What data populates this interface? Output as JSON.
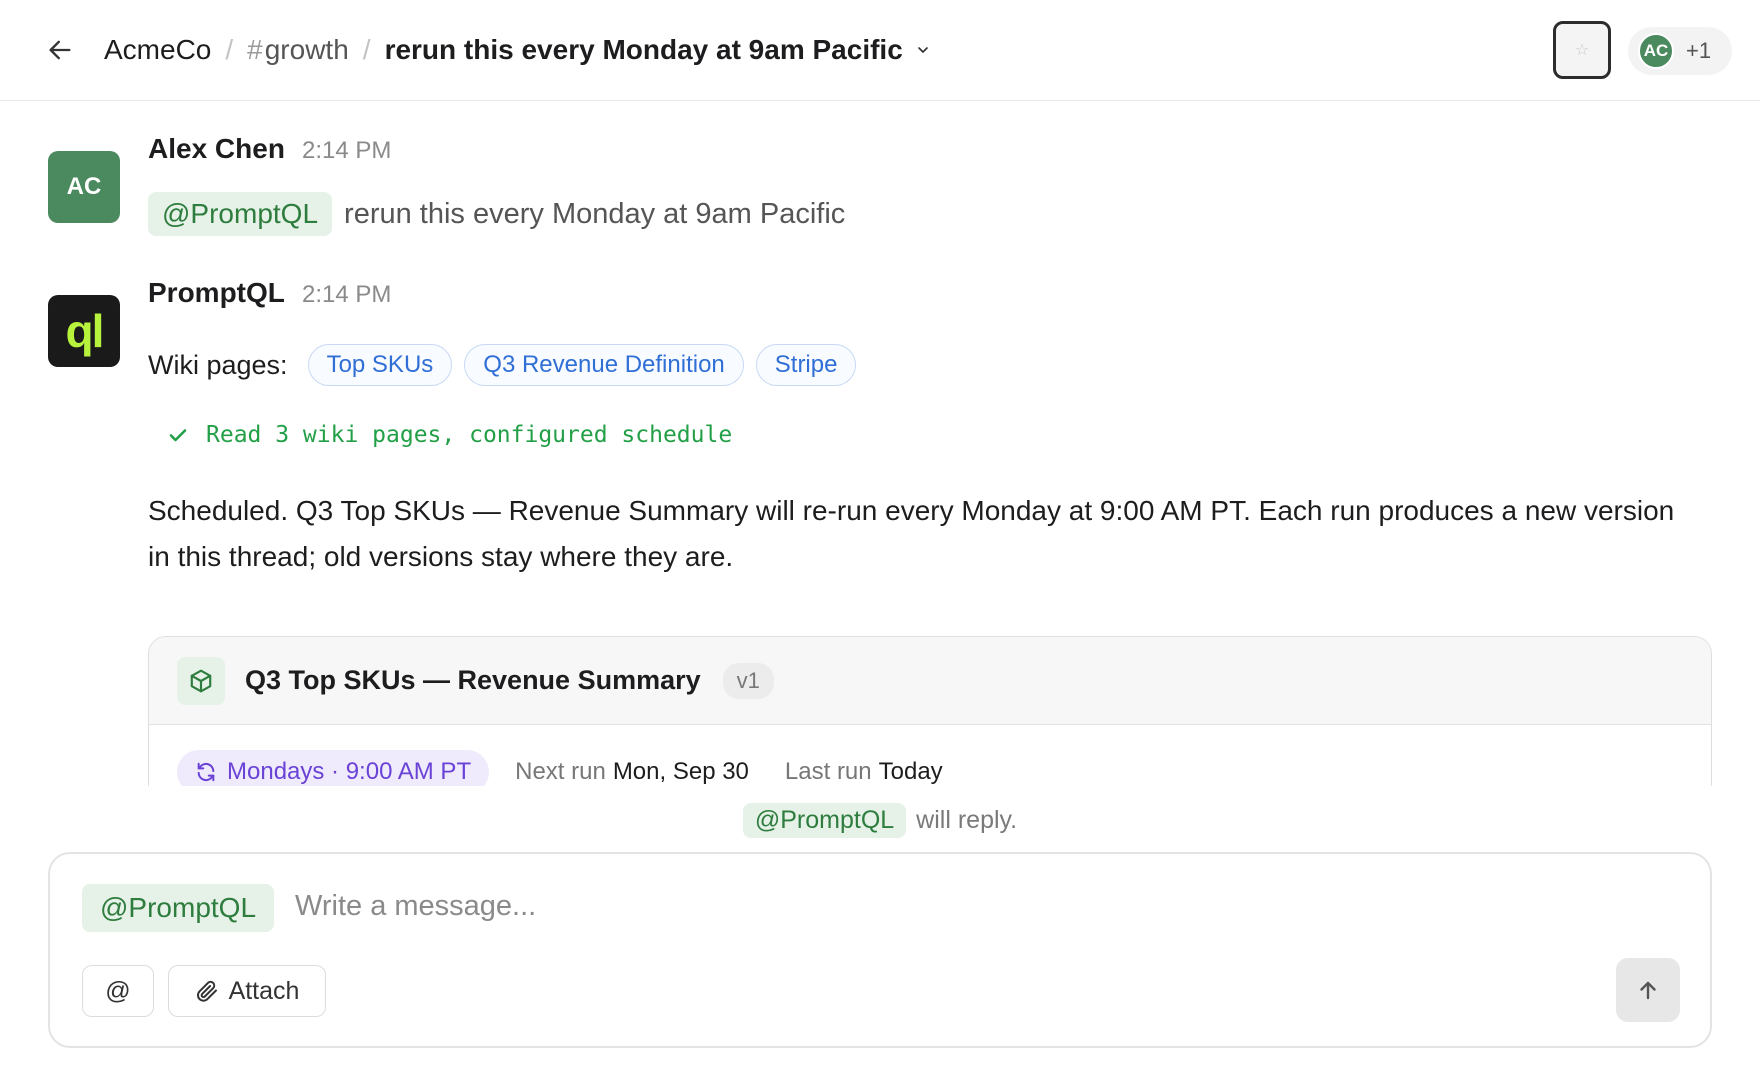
{
  "header": {
    "workspace": "AcmeCo",
    "separator": "/",
    "channel_prefix": "#",
    "channel": "growth",
    "thread_title": "rerun this every Monday at 9am Pacific",
    "star_icon": "star-icon",
    "presence": {
      "avatar_initials": "AC",
      "extra_count": "+1",
      "avatar_color": "#4a8a5e"
    }
  },
  "messages": [
    {
      "sender": "Alex Chen",
      "avatar_initials": "AC",
      "avatar_color": "#4a8a5e",
      "time": "2:14 PM",
      "mention": "@PromptQL",
      "text": "rerun this every Monday at 9am Pacific"
    },
    {
      "sender": "PromptQL",
      "avatar_text": "ql",
      "avatar_color": "#1a1a1a",
      "time": "2:14 PM",
      "wiki_label": "Wiki pages:",
      "wiki_pages": [
        "Top SKUs",
        "Q3 Revenue Definition",
        "Stripe"
      ],
      "tool_status": "Read 3 wiki pages, configured schedule",
      "text": "Scheduled. Q3 Top SKUs — Revenue Summary will re-run every Monday at 9:00 AM PT. Each run produces a new version in this thread; old versions stay where they are.",
      "artifact": {
        "icon": "cube-icon",
        "title": "Q3 Top SKUs — Revenue Summary",
        "version": "v1",
        "schedule": "Mondays · 9:00 AM PT",
        "next_run_label": "Next run",
        "next_run_value": "Mon, Sep 30",
        "last_run_label": "Last run",
        "last_run_value": "Today"
      }
    }
  ],
  "composer": {
    "reply_hint_mention": "@PromptQL",
    "reply_hint_text": "will reply.",
    "mention_chip": "@PromptQL",
    "placeholder": "Write a message...",
    "at_button": "@",
    "attach_button": "Attach"
  },
  "colors": {
    "mention_bg": "#e6f2e8",
    "mention_fg": "#2e7d3e",
    "link_blue": "#2f6fd6",
    "success_green": "#23a047",
    "schedule_purple": "#6a43d6"
  }
}
